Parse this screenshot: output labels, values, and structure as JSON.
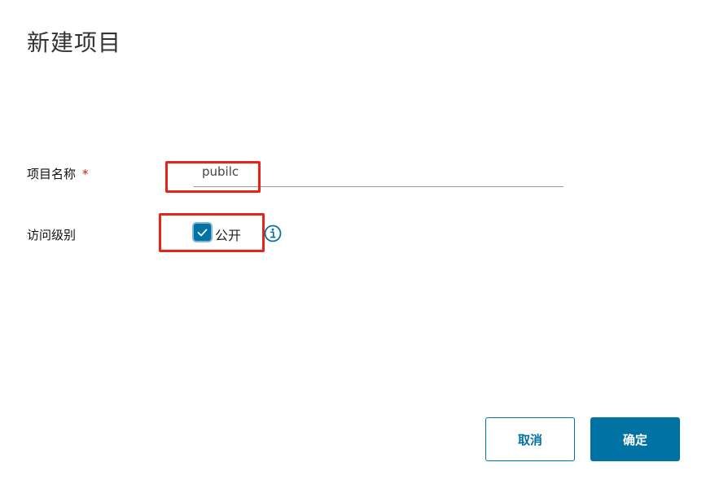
{
  "dialog": {
    "title": "新建项目"
  },
  "form": {
    "project_name": {
      "label": "项目名称",
      "required_mark": "*",
      "value": "pubilc"
    },
    "access_level": {
      "label": "访问级别",
      "checkbox_label": "公开",
      "checked": true,
      "info_icon": "info-circle-icon"
    }
  },
  "actions": {
    "cancel_label": "取消",
    "confirm_label": "确定"
  },
  "colors": {
    "primary": "#0072a3",
    "required": "#c92100",
    "annotation": "#e8231a"
  }
}
